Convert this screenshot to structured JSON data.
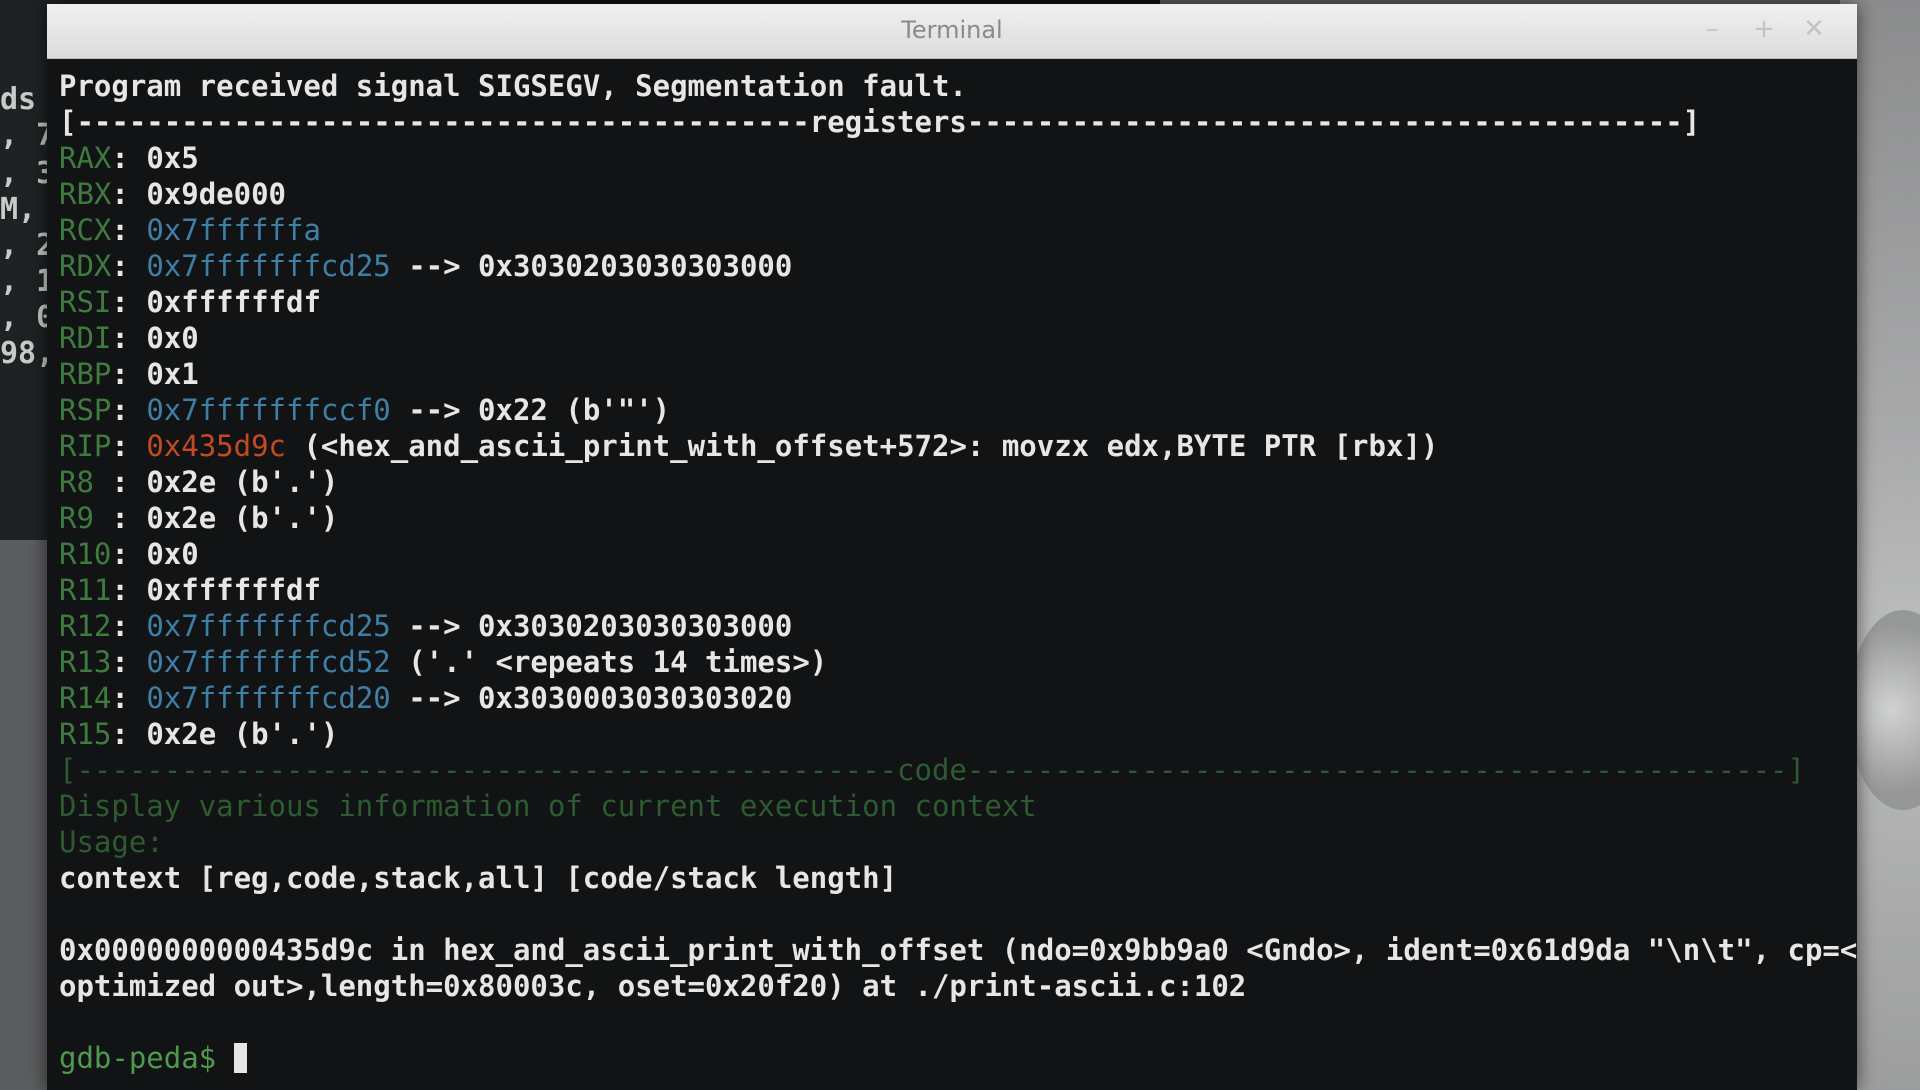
{
  "window": {
    "title": "Terminal",
    "controls": {
      "minimize": "–",
      "maximize": "+",
      "close": "✕"
    }
  },
  "background": {
    "fragments": [
      "ds",
      ", 7",
      ", 3",
      "M, ",
      ", 2",
      ", 1",
      ", 0",
      "98,"
    ]
  },
  "terminal": {
    "signal_line": "Program received signal SIGSEGV, Segmentation fault.",
    "registers_header": "[------------------------------------------registers-----------------------------------------]",
    "registers": [
      {
        "name": "RAX",
        "value": "0x5",
        "deref": ""
      },
      {
        "name": "RBX",
        "value": "0x9de000",
        "deref": ""
      },
      {
        "name": "RCX",
        "value": "0x7ffffffa",
        "deref": ""
      },
      {
        "name": "RDX",
        "value": "0x7fffffffcd25",
        "deref": "--> 0x3030203030303000"
      },
      {
        "name": "RSI",
        "value": "0xffffffdf",
        "deref": ""
      },
      {
        "name": "RDI",
        "value": "0x0",
        "deref": ""
      },
      {
        "name": "RBP",
        "value": "0x1",
        "deref": ""
      },
      {
        "name": "RSP",
        "value": "0x7fffffffccf0",
        "deref": "--> 0x22 (b'\"')"
      },
      {
        "name": "RIP",
        "value": "0x435d9c",
        "deref": "(<hex_and_ascii_print_with_offset+572>: movzx edx,BYTE PTR [rbx])"
      },
      {
        "name": "R8 ",
        "value": "0x2e",
        "deref": "(b'.')"
      },
      {
        "name": "R9 ",
        "value": "0x2e",
        "deref": "(b'.')"
      },
      {
        "name": "R10",
        "value": "0x0",
        "deref": ""
      },
      {
        "name": "R11",
        "value": "0xffffffdf",
        "deref": ""
      },
      {
        "name": "R12",
        "value": "0x7fffffffcd25",
        "deref": "--> 0x3030203030303000"
      },
      {
        "name": "R13",
        "value": "0x7fffffffcd52",
        "deref": "('.' <repeats 14 times>)"
      },
      {
        "name": "R14",
        "value": "0x7fffffffcd20",
        "deref": "--> 0x3030003030303020"
      },
      {
        "name": "R15",
        "value": "0x2e",
        "deref": "(b'.')"
      }
    ],
    "code_header": "[-----------------------------------------------code-----------------------------------------------]",
    "help_desc": "Display various information of current execution context",
    "usage_label": "Usage:",
    "usage_cmd": "context [reg,code,stack,all] [code/stack length]",
    "frame_line1": "0x0000000000435d9c in hex_and_ascii_print_with_offset (ndo=0x9bb9a0 <Gndo>, ident=0x61d9da \"\\n\\t\", cp=<",
    "frame_line2": "optimized out>,length=0x80003c, oset=0x20f20) at ./print-ascii.c:102",
    "prompt": "gdb-peda$ "
  }
}
